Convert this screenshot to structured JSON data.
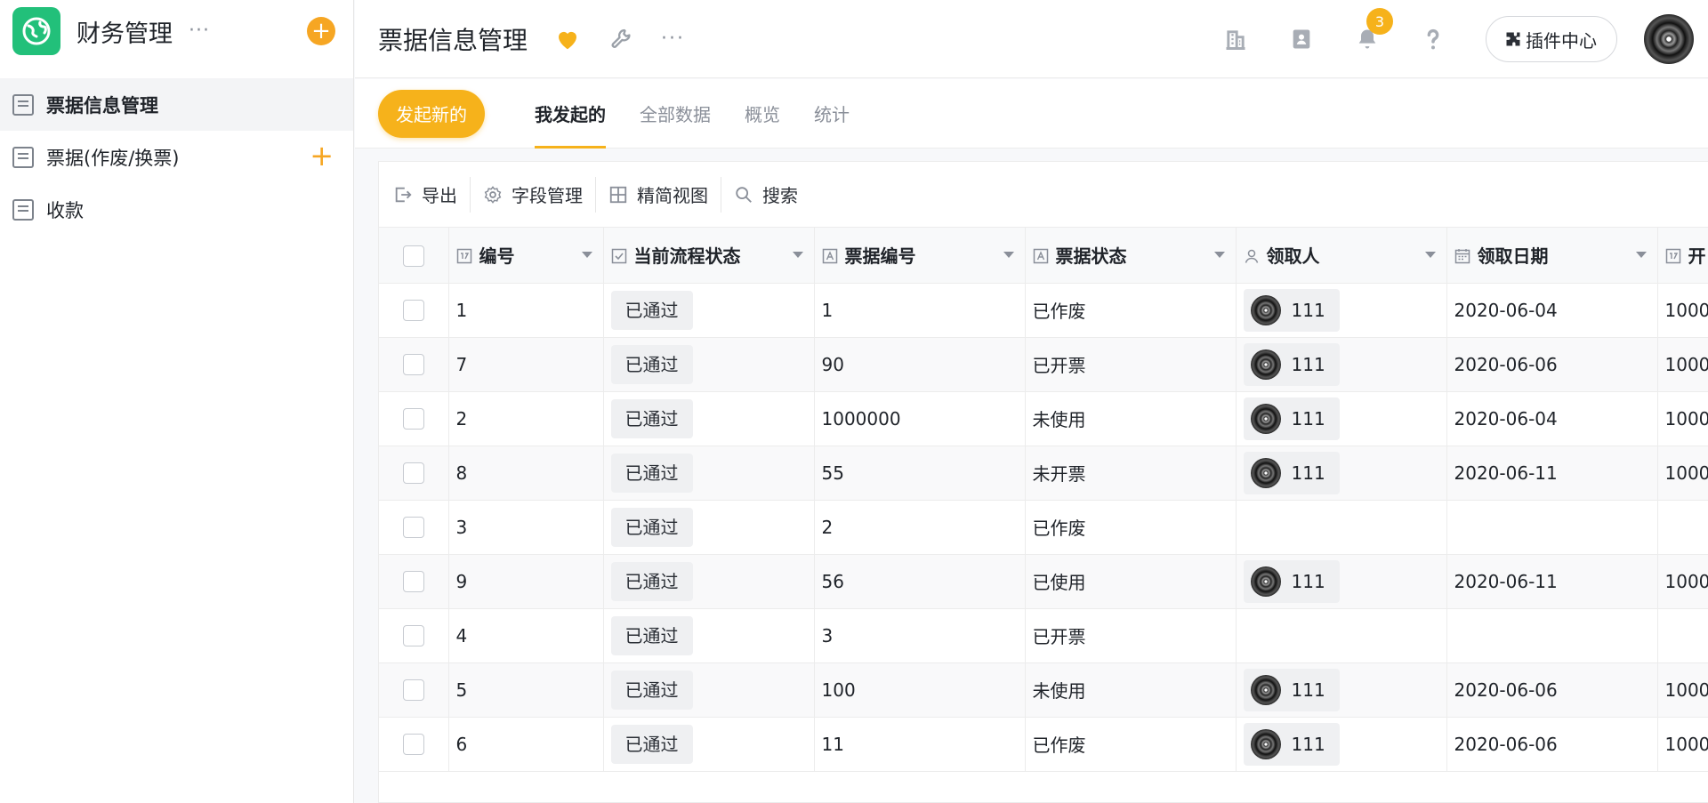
{
  "app": {
    "title": "财务管理",
    "more": "···",
    "add_icon": "plus-circle-icon",
    "accent": "#f6b21b",
    "logo_color": "#22c07a"
  },
  "sidebar": {
    "items": [
      {
        "label": "票据信息管理",
        "icon": "doc-icon",
        "active": true
      },
      {
        "label": "票据(作废/换票)",
        "icon": "doc-icon",
        "has_add": true
      },
      {
        "label": "收款",
        "icon": "doc-icon"
      }
    ]
  },
  "header": {
    "title": "票据信息管理",
    "more": "···",
    "notification_count": "3",
    "plugin_label": "插件中心"
  },
  "tabs": {
    "new_button": "发起新的",
    "items": [
      "我发起的",
      "全部数据",
      "概览",
      "统计"
    ],
    "active_index": 0
  },
  "toolbar": {
    "export": "导出",
    "fields": "字段管理",
    "compact_view": "精简视图",
    "search": "搜索"
  },
  "table": {
    "columns": [
      "编号",
      "当前流程状态",
      "票据编号",
      "票据状态",
      "领取人",
      "领取日期",
      "开"
    ],
    "rows": [
      {
        "id": "1",
        "flow": "已通过",
        "no": "1",
        "state": "已作废",
        "user": "111",
        "date": "2020-06-04",
        "extra": "1000"
      },
      {
        "id": "7",
        "flow": "已通过",
        "no": "90",
        "state": "已开票",
        "user": "111",
        "date": "2020-06-06",
        "extra": "1000"
      },
      {
        "id": "2",
        "flow": "已通过",
        "no": "1000000",
        "state": "未使用",
        "user": "111",
        "date": "2020-06-04",
        "extra": "1000"
      },
      {
        "id": "8",
        "flow": "已通过",
        "no": "55",
        "state": "未开票",
        "user": "111",
        "date": "2020-06-11",
        "extra": "1000"
      },
      {
        "id": "3",
        "flow": "已通过",
        "no": "2",
        "state": "已作废",
        "user": "",
        "date": "",
        "extra": ""
      },
      {
        "id": "9",
        "flow": "已通过",
        "no": "56",
        "state": "已使用",
        "user": "111",
        "date": "2020-06-11",
        "extra": "1000"
      },
      {
        "id": "4",
        "flow": "已通过",
        "no": "3",
        "state": "已开票",
        "user": "",
        "date": "",
        "extra": ""
      },
      {
        "id": "5",
        "flow": "已通过",
        "no": "100",
        "state": "未使用",
        "user": "111",
        "date": "2020-06-06",
        "extra": "1000"
      },
      {
        "id": "6",
        "flow": "已通过",
        "no": "11",
        "state": "已作废",
        "user": "111",
        "date": "2020-06-06",
        "extra": "1000"
      }
    ]
  }
}
